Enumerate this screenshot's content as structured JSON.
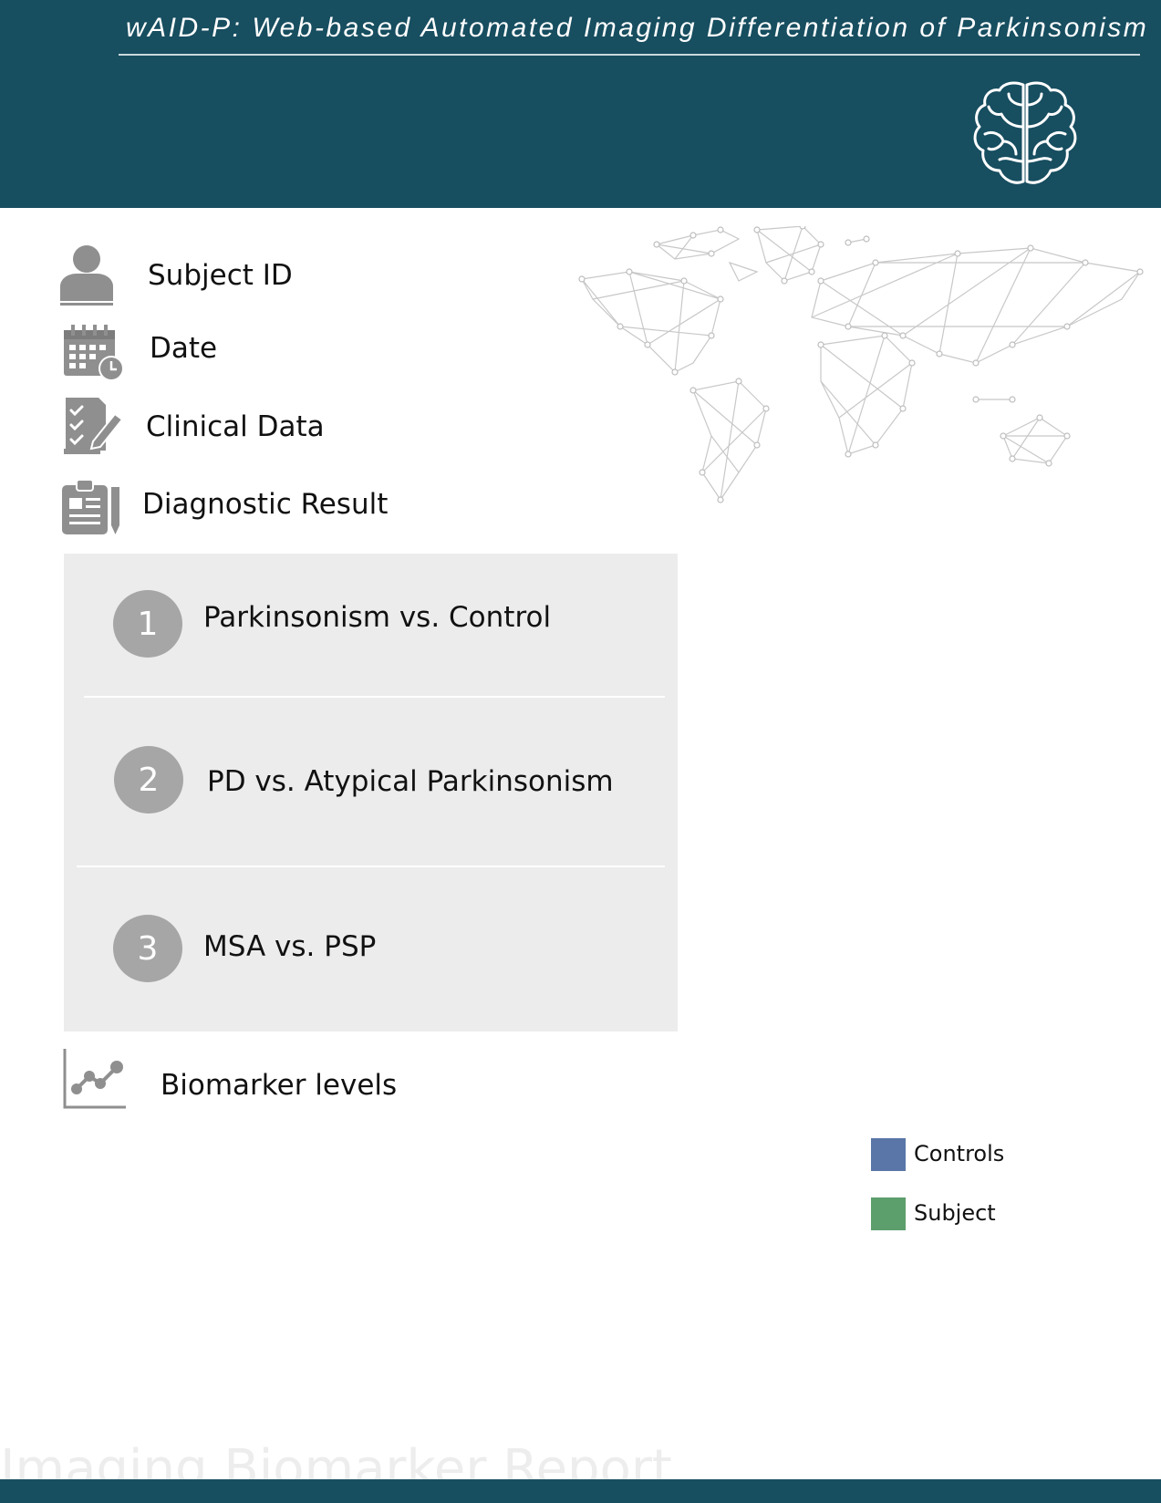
{
  "header": {
    "title": "wAID-P: Web-based Automated Imaging Differentiation of Parkinsonism",
    "logo_icon": "brain-icon",
    "background": "#174e60"
  },
  "fields": {
    "subject_id": {
      "label": "Subject ID",
      "icon": "person-icon"
    },
    "date": {
      "label": "Date",
      "icon": "calendar-clock-icon"
    },
    "clinical_data": {
      "label": "Clinical Data",
      "icon": "clipboard-checklist-icon"
    },
    "diagnostic_result": {
      "label": "Diagnostic Result",
      "icon": "clipboard-report-icon"
    }
  },
  "results": [
    {
      "number": "1",
      "label": "Parkinsonism vs. Control"
    },
    {
      "number": "2",
      "label": "PD vs. Atypical Parkinsonism"
    },
    {
      "number": "3",
      "label": "MSA vs. PSP"
    }
  ],
  "biomarkers": {
    "label": "Biomarker levels",
    "icon": "line-chart-icon",
    "legend": [
      {
        "label": "Controls",
        "color": "#5a76a8"
      },
      {
        "label": "Subject",
        "color": "#5d9e6d"
      }
    ]
  },
  "decoration": {
    "world_map": "world-network-map"
  },
  "watermark": "Imaging Biomarker Report"
}
